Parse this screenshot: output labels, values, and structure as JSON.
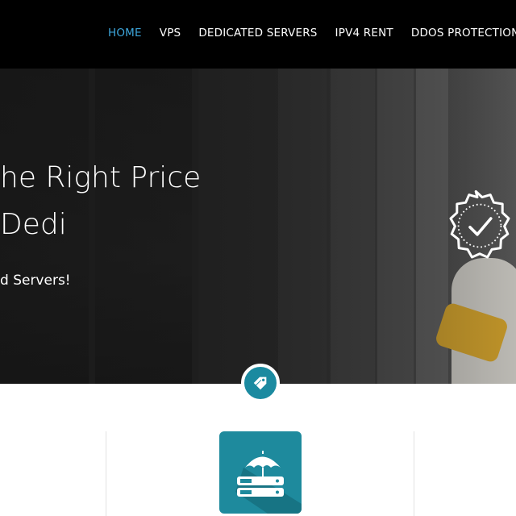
{
  "nav": {
    "items": [
      {
        "label": "HOME",
        "active": true
      },
      {
        "label": "VPS",
        "active": false
      },
      {
        "label": "DEDICATED SERVERS",
        "active": false
      },
      {
        "label": "IPV4 RENT",
        "active": false
      },
      {
        "label": "DDOS PROTECTION",
        "active": false
      }
    ],
    "active_color": "#3da6dc"
  },
  "hero": {
    "title_line1": "he Right Price",
    "title_line2": "Dedi",
    "subtitle": "d Servers!"
  },
  "icons": {
    "badge": "checkmark-badge-icon",
    "tag": "price-tag-icon",
    "feature": "umbrella-server-icon"
  },
  "colors": {
    "accent_teal": "#1e8a9d",
    "nav_bg": "#000000"
  }
}
